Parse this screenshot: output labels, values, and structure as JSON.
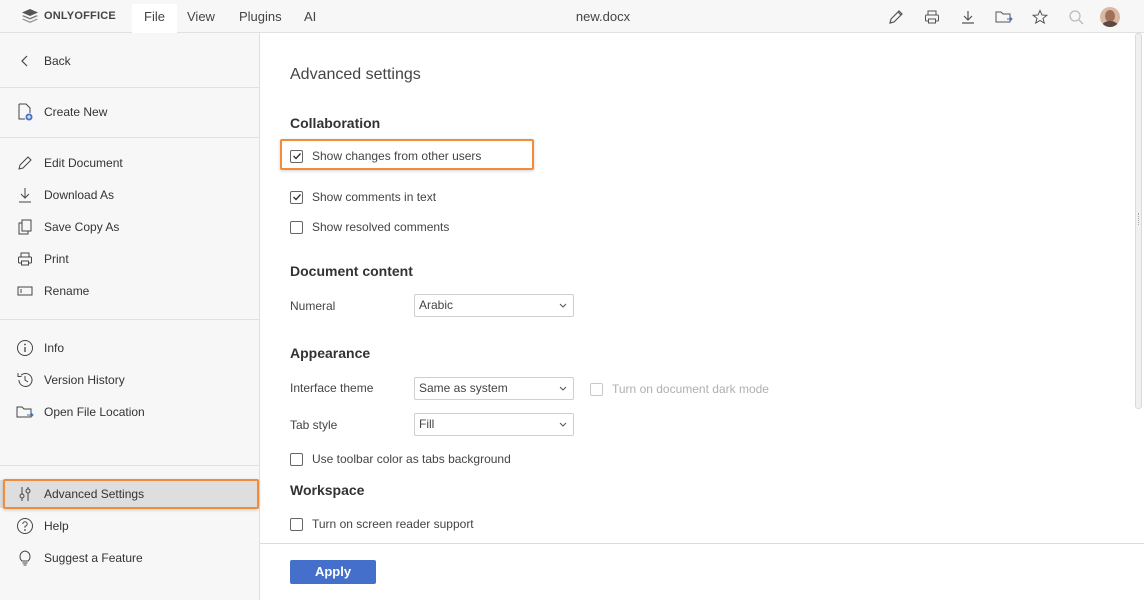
{
  "app": {
    "brand": "ONLYOFFICE",
    "doc_title": "new.docx",
    "menu": [
      "File",
      "View",
      "Plugins",
      "AI"
    ],
    "active_menu": "File"
  },
  "toolbar_icons": [
    "edit-icon",
    "print-icon",
    "download-icon",
    "folder-icon",
    "star-icon",
    "search-icon",
    "avatar"
  ],
  "sidebar": {
    "back": "Back",
    "create_new": "Create New",
    "edit_document": "Edit Document",
    "download_as": "Download As",
    "save_copy_as": "Save Copy As",
    "print": "Print",
    "rename": "Rename",
    "info": "Info",
    "version_history": "Version History",
    "open_file_location": "Open File Location",
    "advanced_settings": "Advanced Settings",
    "help": "Help",
    "suggest_feature": "Suggest a Feature"
  },
  "settings": {
    "title": "Advanced settings",
    "collaboration": {
      "heading": "Collaboration",
      "show_changes": {
        "label": "Show changes from other users",
        "checked": true
      },
      "show_comments": {
        "label": "Show comments in text",
        "checked": true
      },
      "show_resolved": {
        "label": "Show resolved comments",
        "checked": false
      }
    },
    "document_content": {
      "heading": "Document content",
      "numeral_label": "Numeral",
      "numeral_value": "Arabic"
    },
    "appearance": {
      "heading": "Appearance",
      "theme_label": "Interface theme",
      "theme_value": "Same as system",
      "dark_mode": {
        "label": "Turn on document dark mode",
        "checked": false,
        "disabled": true
      },
      "tab_style_label": "Tab style",
      "tab_style_value": "Fill",
      "toolbar_color": {
        "label": "Use toolbar color as tabs background",
        "checked": false
      }
    },
    "workspace": {
      "heading": "Workspace",
      "screen_reader": {
        "label": "Turn on screen reader support",
        "checked": false
      }
    },
    "apply": "Apply"
  },
  "colors": {
    "accent": "#446fca",
    "highlight": "#f08c3a"
  }
}
